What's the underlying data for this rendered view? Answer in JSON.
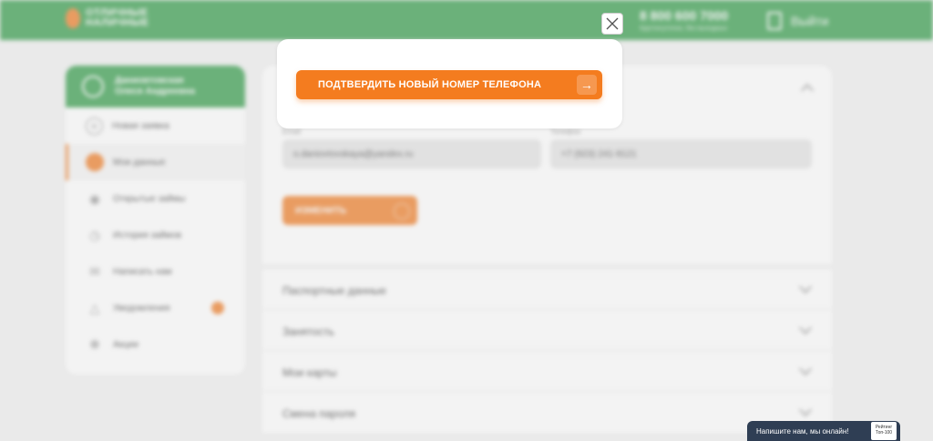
{
  "header": {
    "logo_line1": "ОТЛИЧНЫЕ",
    "logo_line2": "НАЛИЧНЫЕ",
    "phone": "8 800 600 7000",
    "phone_sub": "Круглосуточно, без выходных",
    "logout": "Выйти"
  },
  "sidebar": {
    "user_name_line1": "Даниовтовская",
    "user_name_line2": "Олеся Андреевна",
    "items": [
      {
        "label": "Новая заявка"
      },
      {
        "label": "Мои данные"
      },
      {
        "label": "Открытые займы"
      },
      {
        "label": "История займов"
      },
      {
        "label": "Написать нам"
      },
      {
        "label": "Уведомления"
      },
      {
        "label": "Акции"
      }
    ]
  },
  "main": {
    "email_label": "Email",
    "email_value": "o.daniovtovskaya@yandex.ru",
    "phone_label": "Телефон",
    "phone_value": "+7 (923) 241-9121",
    "change_button": "ИЗМЕНИТЬ",
    "sections": [
      {
        "label": "Паспортные данные"
      },
      {
        "label": "Занятость"
      },
      {
        "label": "Мои карты"
      },
      {
        "label": "Смена пароля"
      }
    ]
  },
  "modal": {
    "confirm_label": "ПОДТВЕРДИТЬ НОВЫЙ НОМЕР ТЕЛЕФОНА",
    "arrow": "→"
  },
  "chat": {
    "label": "Напишите нам, мы онлайн!",
    "badge_line1": "Рейтинг",
    "badge_line2": "Топ-100"
  },
  "colors": {
    "brand_green": "#2e9a45",
    "accent_orange": "#f47c1f"
  }
}
